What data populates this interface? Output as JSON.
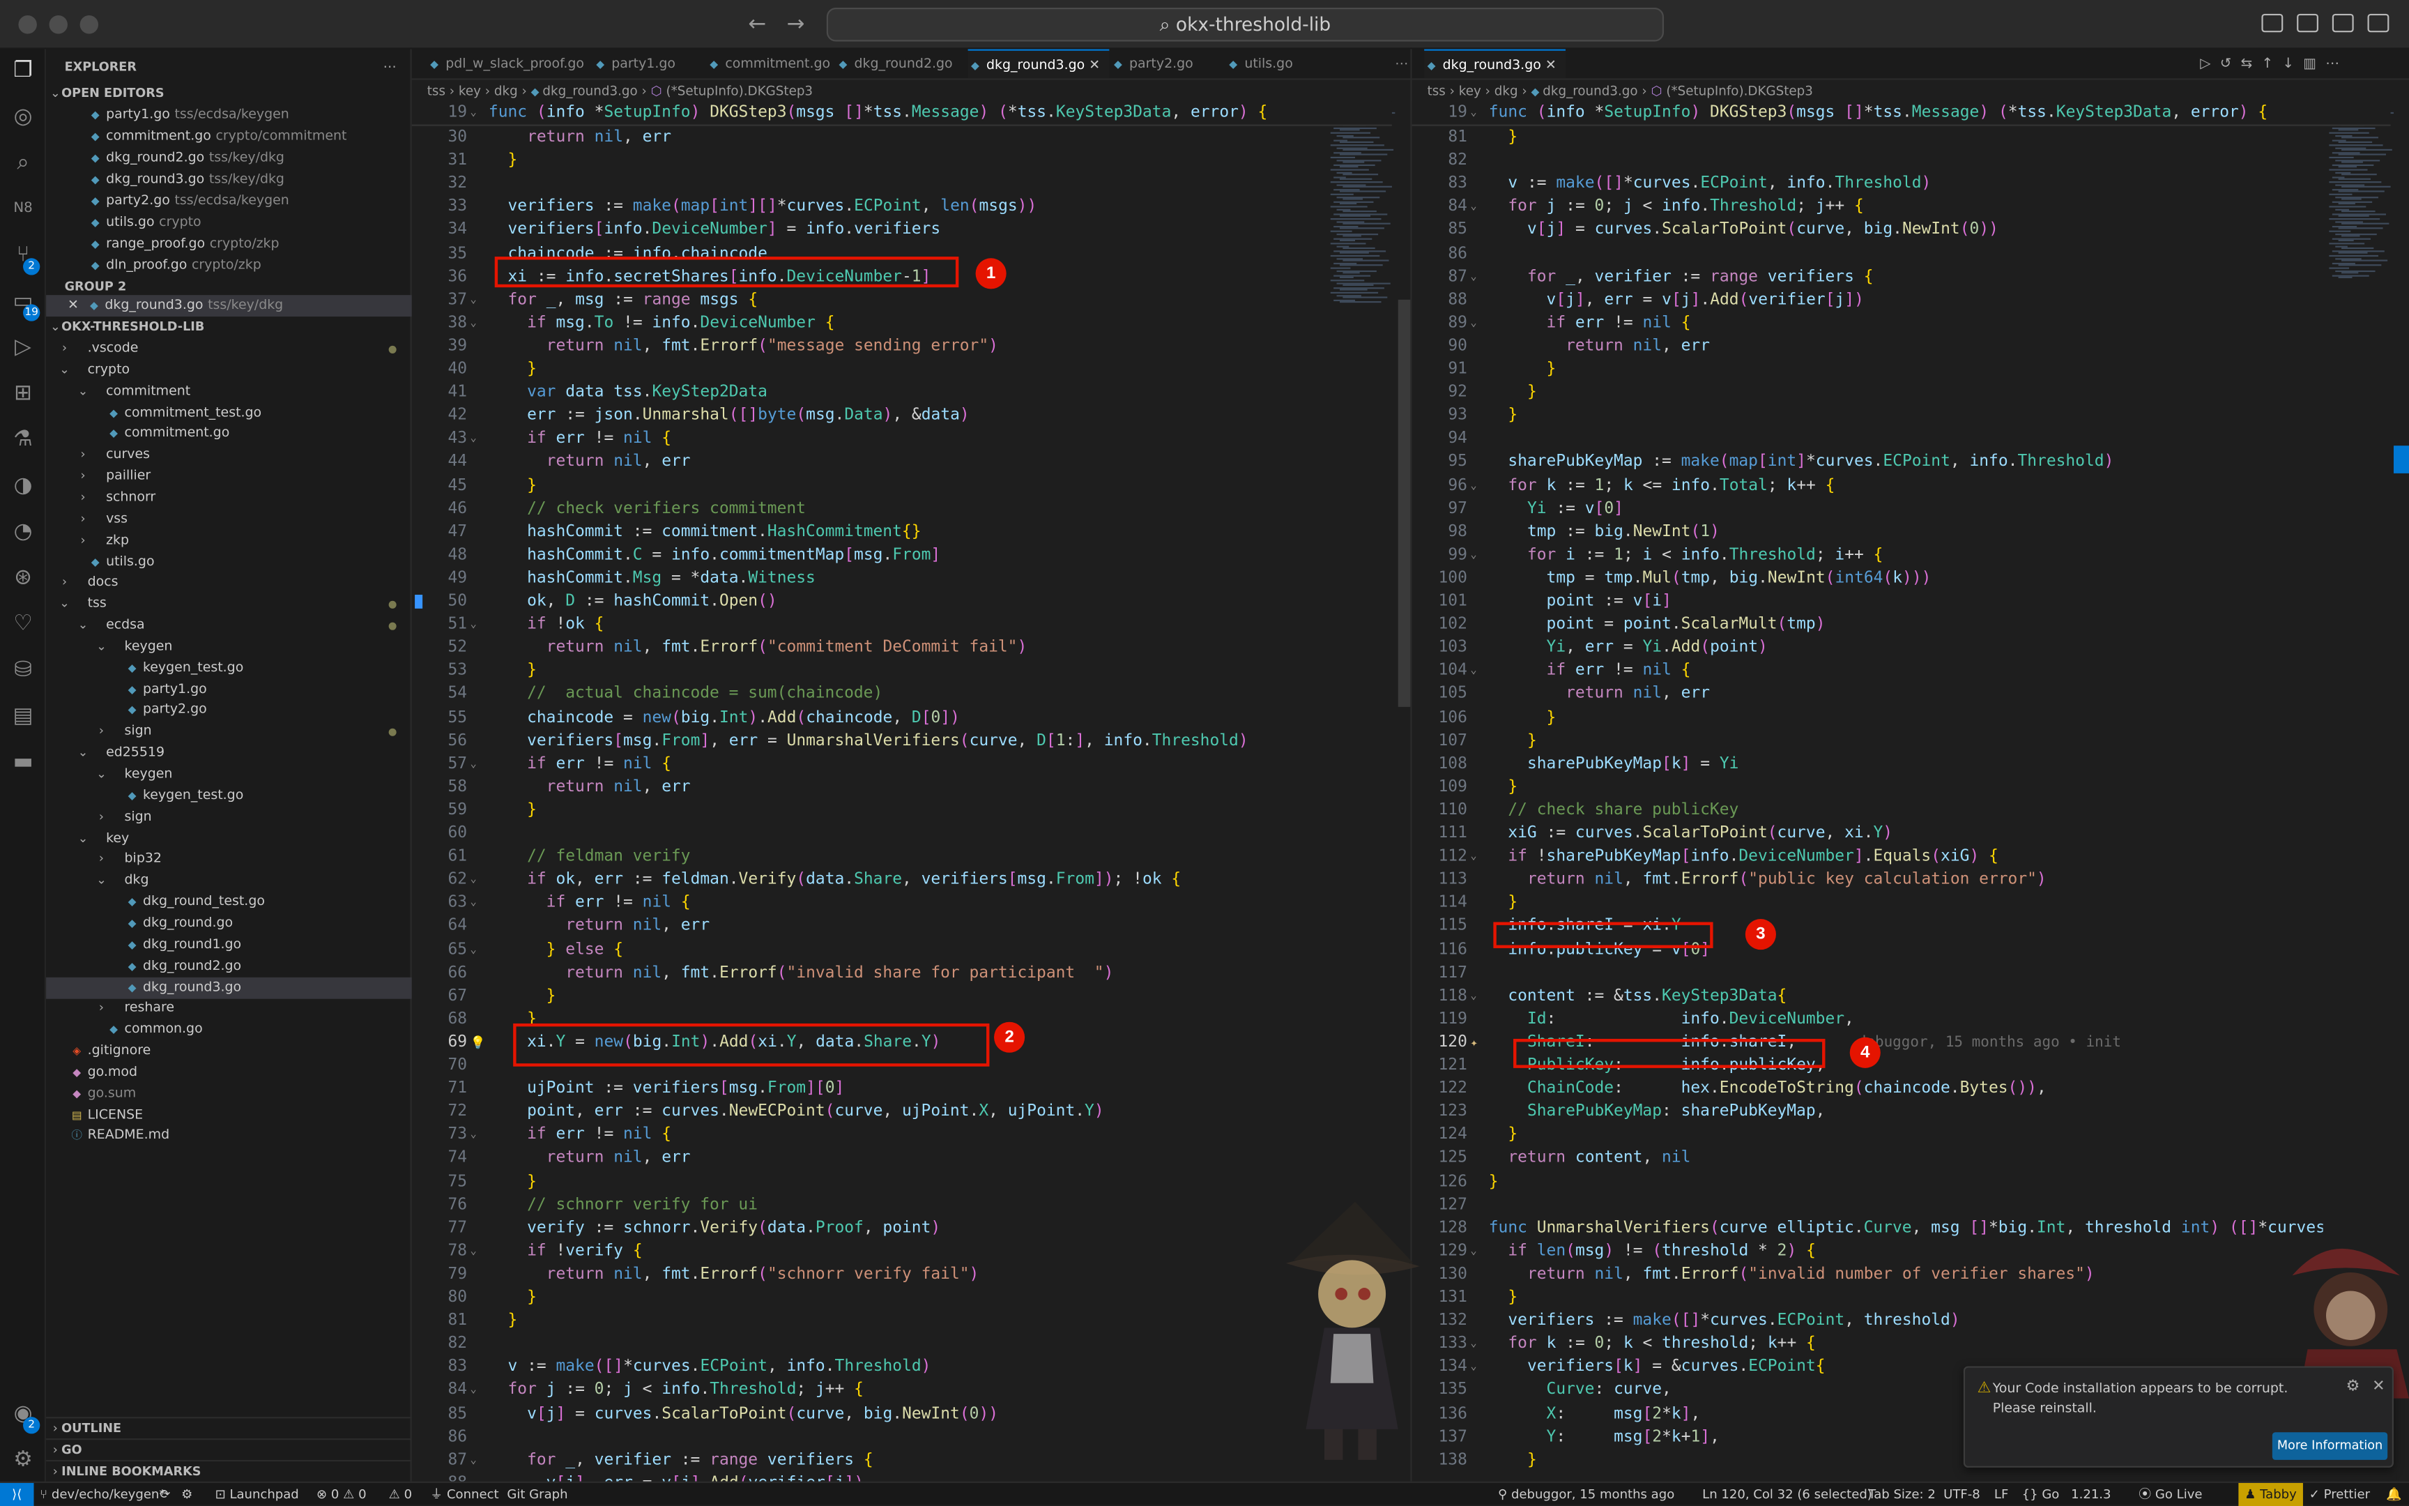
{
  "window": {
    "title": "okx-threshold-lib"
  },
  "explorer": {
    "header": "EXPLORER",
    "open_editors_label": "OPEN EDITORS",
    "group2_label": "GROUP 2",
    "project_label": "OKX-THRESHOLD-LIB",
    "outline_label": "OUTLINE",
    "go_label": "GO",
    "bookmarks_label": "INLINE BOOKMARKS",
    "open_editors": [
      {
        "name": "party1.go",
        "path": "tss/ecdsa/keygen"
      },
      {
        "name": "commitment.go",
        "path": "crypto/commitment"
      },
      {
        "name": "dkg_round2.go",
        "path": "tss/key/dkg"
      },
      {
        "name": "dkg_round3.go",
        "path": "tss/key/dkg"
      },
      {
        "name": "party2.go",
        "path": "tss/ecdsa/keygen"
      },
      {
        "name": "utils.go",
        "path": "crypto"
      },
      {
        "name": "range_proof.go",
        "path": "crypto/zkp"
      },
      {
        "name": "dln_proof.go",
        "path": "crypto/zkp"
      }
    ],
    "group2_items": [
      {
        "name": "dkg_round3.go",
        "path": "tss/key/dkg"
      }
    ],
    "tree": [
      {
        "name": ".vscode",
        "depth": 0,
        "type": "folder",
        "open": false,
        "dot": true
      },
      {
        "name": "crypto",
        "depth": 0,
        "type": "folder",
        "open": true
      },
      {
        "name": "commitment",
        "depth": 1,
        "type": "folder",
        "open": true
      },
      {
        "name": "commitment_test.go",
        "depth": 2,
        "type": "go"
      },
      {
        "name": "commitment.go",
        "depth": 2,
        "type": "go"
      },
      {
        "name": "curves",
        "depth": 1,
        "type": "folder",
        "open": false
      },
      {
        "name": "paillier",
        "depth": 1,
        "type": "folder",
        "open": false
      },
      {
        "name": "schnorr",
        "depth": 1,
        "type": "folder",
        "open": false
      },
      {
        "name": "vss",
        "depth": 1,
        "type": "folder",
        "open": false
      },
      {
        "name": "zkp",
        "depth": 1,
        "type": "folder",
        "open": false
      },
      {
        "name": "utils.go",
        "depth": 1,
        "type": "go"
      },
      {
        "name": "docs",
        "depth": 0,
        "type": "folder",
        "open": false
      },
      {
        "name": "tss",
        "depth": 0,
        "type": "folder",
        "open": true,
        "dot": true
      },
      {
        "name": "ecdsa",
        "depth": 1,
        "type": "folder",
        "open": true,
        "dot": true
      },
      {
        "name": "keygen",
        "depth": 2,
        "type": "folder",
        "open": true
      },
      {
        "name": "keygen_test.go",
        "depth": 3,
        "type": "go"
      },
      {
        "name": "party1.go",
        "depth": 3,
        "type": "go"
      },
      {
        "name": "party2.go",
        "depth": 3,
        "type": "go"
      },
      {
        "name": "sign",
        "depth": 2,
        "type": "folder",
        "open": false,
        "dot": true
      },
      {
        "name": "ed25519",
        "depth": 1,
        "type": "folder",
        "open": true
      },
      {
        "name": "keygen",
        "depth": 2,
        "type": "folder",
        "open": true
      },
      {
        "name": "keygen_test.go",
        "depth": 3,
        "type": "go"
      },
      {
        "name": "sign",
        "depth": 2,
        "type": "folder",
        "open": false
      },
      {
        "name": "key",
        "depth": 1,
        "type": "folder",
        "open": true
      },
      {
        "name": "bip32",
        "depth": 2,
        "type": "folder",
        "open": false
      },
      {
        "name": "dkg",
        "depth": 2,
        "type": "folder",
        "open": true
      },
      {
        "name": "dkg_round_test.go",
        "depth": 3,
        "type": "go"
      },
      {
        "name": "dkg_round.go",
        "depth": 3,
        "type": "go"
      },
      {
        "name": "dkg_round1.go",
        "depth": 3,
        "type": "go"
      },
      {
        "name": "dkg_round2.go",
        "depth": 3,
        "type": "go"
      },
      {
        "name": "dkg_round3.go",
        "depth": 3,
        "type": "go",
        "selected": true
      },
      {
        "name": "reshare",
        "depth": 2,
        "type": "folder",
        "open": false
      },
      {
        "name": "common.go",
        "depth": 2,
        "type": "go"
      },
      {
        "name": ".gitignore",
        "depth": 0,
        "type": "git"
      },
      {
        "name": "go.mod",
        "depth": 0,
        "type": "mod"
      },
      {
        "name": "go.sum",
        "depth": 0,
        "type": "mod"
      },
      {
        "name": "LICENSE",
        "depth": 0,
        "type": "lic"
      },
      {
        "name": "README.md",
        "depth": 0,
        "type": "md"
      }
    ]
  },
  "left_tabs": [
    "pdl_w_slack_proof.go",
    "party1.go",
    "commitment.go",
    "dkg_round2.go",
    "dkg_round3.go",
    "party2.go",
    "utils.go"
  ],
  "left_active_tab": 4,
  "right_tabs": [
    "dkg_round3.go"
  ],
  "breadcrumb": [
    "tss",
    "key",
    "dkg",
    "dkg_round3.go",
    "(*SetupInfo).DKGStep3"
  ],
  "left_sticky": {
    "num": "19",
    "text": "func (info *SetupInfo) DKGStep3(msgs []*tss.Message) (*tss.KeyStep3Data, error) {"
  },
  "right_sticky": {
    "num": "19",
    "text": "func (info *SetupInfo) DKGStep3(msgs []*tss.Message) (*tss.KeyStep3Data, error) {"
  },
  "left_code": [
    [
      "30",
      "\t\treturn nil, err"
    ],
    [
      "31",
      "\t}"
    ],
    [
      "32",
      ""
    ],
    [
      "33",
      "\tverifiers := make(map[int][]*curves.ECPoint, len(msgs))"
    ],
    [
      "34",
      "\tverifiers[info.DeviceNumber] = info.verifiers"
    ],
    [
      "35",
      "\tchaincode := info.chaincode"
    ],
    [
      "36",
      "\txi := info.secretShares[info.DeviceNumber-1]"
    ],
    [
      "37",
      "\tfor _, msg := range msgs {"
    ],
    [
      "38",
      "\t\tif msg.To != info.DeviceNumber {"
    ],
    [
      "39",
      "\t\t\treturn nil, fmt.Errorf(\"message sending error\")"
    ],
    [
      "40",
      "\t\t}"
    ],
    [
      "41",
      "\t\tvar data tss.KeyStep2Data"
    ],
    [
      "42",
      "\t\terr := json.Unmarshal([]byte(msg.Data), &data)"
    ],
    [
      "43",
      "\t\tif err != nil {"
    ],
    [
      "44",
      "\t\t\treturn nil, err"
    ],
    [
      "45",
      "\t\t}"
    ],
    [
      "46",
      "\t\t// check verifiers commitment"
    ],
    [
      "47",
      "\t\thashCommit := commitment.HashCommitment{}"
    ],
    [
      "48",
      "\t\thashCommit.C = info.commitmentMap[msg.From]"
    ],
    [
      "49",
      "\t\thashCommit.Msg = *data.Witness"
    ],
    [
      "50",
      "\t\tok, D := hashCommit.Open()"
    ],
    [
      "51",
      "\t\tif !ok {"
    ],
    [
      "52",
      "\t\t\treturn nil, fmt.Errorf(\"commitment DeCommit fail\")"
    ],
    [
      "53",
      "\t\t}"
    ],
    [
      "54",
      "\t\t//  actual chaincode = sum(chaincode)"
    ],
    [
      "55",
      "\t\tchaincode = new(big.Int).Add(chaincode, D[0])"
    ],
    [
      "56",
      "\t\tverifiers[msg.From], err = UnmarshalVerifiers(curve, D[1:], info.Threshold)"
    ],
    [
      "57",
      "\t\tif err != nil {"
    ],
    [
      "58",
      "\t\t\treturn nil, err"
    ],
    [
      "59",
      "\t\t}"
    ],
    [
      "60",
      ""
    ],
    [
      "61",
      "\t\t// feldman verify"
    ],
    [
      "62",
      "\t\tif ok, err := feldman.Verify(data.Share, verifiers[msg.From]); !ok {"
    ],
    [
      "63",
      "\t\t\tif err != nil {"
    ],
    [
      "64",
      "\t\t\t\treturn nil, err"
    ],
    [
      "65",
      "\t\t\t} else {"
    ],
    [
      "66",
      "\t\t\t\treturn nil, fmt.Errorf(\"invalid share for participant  \")"
    ],
    [
      "67",
      "\t\t\t}"
    ],
    [
      "68",
      "\t\t}"
    ],
    [
      "69",
      "\t\txi.Y = new(big.Int).Add(xi.Y, data.Share.Y)"
    ],
    [
      "70",
      ""
    ],
    [
      "71",
      "\t\tujPoint := verifiers[msg.From][0]"
    ],
    [
      "72",
      "\t\tpoint, err := curves.NewECPoint(curve, ujPoint.X, ujPoint.Y)"
    ],
    [
      "73",
      "\t\tif err != nil {"
    ],
    [
      "74",
      "\t\t\treturn nil, err"
    ],
    [
      "75",
      "\t\t}"
    ],
    [
      "76",
      "\t\t// schnorr verify for ui"
    ],
    [
      "77",
      "\t\tverify := schnorr.Verify(data.Proof, point)"
    ],
    [
      "78",
      "\t\tif !verify {"
    ],
    [
      "79",
      "\t\t\treturn nil, fmt.Errorf(\"schnorr verify fail\")"
    ],
    [
      "80",
      "\t\t}"
    ],
    [
      "81",
      "\t}"
    ],
    [
      "82",
      ""
    ],
    [
      "83",
      "\tv := make([]*curves.ECPoint, info.Threshold)"
    ],
    [
      "84",
      "\tfor j := 0; j < info.Threshold; j++ {"
    ],
    [
      "85",
      "\t\tv[j] = curves.ScalarToPoint(curve, big.NewInt(0))"
    ],
    [
      "86",
      ""
    ],
    [
      "87",
      "\t\tfor _, verifier := range verifiers {"
    ],
    [
      "88",
      "\t\t\tv[j], err = v[j].Add(verifier[j])"
    ]
  ],
  "right_code": [
    [
      "81",
      "\t}"
    ],
    [
      "82",
      ""
    ],
    [
      "83",
      "\tv := make([]*curves.ECPoint, info.Threshold)"
    ],
    [
      "84",
      "\tfor j := 0; j < info.Threshold; j++ {"
    ],
    [
      "85",
      "\t\tv[j] = curves.ScalarToPoint(curve, big.NewInt(0))"
    ],
    [
      "86",
      ""
    ],
    [
      "87",
      "\t\tfor _, verifier := range verifiers {"
    ],
    [
      "88",
      "\t\t\tv[j], err = v[j].Add(verifier[j])"
    ],
    [
      "89",
      "\t\t\tif err != nil {"
    ],
    [
      "90",
      "\t\t\t\treturn nil, err"
    ],
    [
      "91",
      "\t\t\t}"
    ],
    [
      "92",
      "\t\t}"
    ],
    [
      "93",
      "\t}"
    ],
    [
      "94",
      ""
    ],
    [
      "95",
      "\tsharePubKeyMap := make(map[int]*curves.ECPoint, info.Threshold)"
    ],
    [
      "96",
      "\tfor k := 1; k <= info.Total; k++ {"
    ],
    [
      "97",
      "\t\tYi := v[0]"
    ],
    [
      "98",
      "\t\ttmp := big.NewInt(1)"
    ],
    [
      "99",
      "\t\tfor i := 1; i < info.Threshold; i++ {"
    ],
    [
      "100",
      "\t\t\ttmp = tmp.Mul(tmp, big.NewInt(int64(k)))"
    ],
    [
      "101",
      "\t\t\tpoint := v[i]"
    ],
    [
      "102",
      "\t\t\tpoint = point.ScalarMult(tmp)"
    ],
    [
      "103",
      "\t\t\tYi, err = Yi.Add(point)"
    ],
    [
      "104",
      "\t\t\tif err != nil {"
    ],
    [
      "105",
      "\t\t\t\treturn nil, err"
    ],
    [
      "106",
      "\t\t\t}"
    ],
    [
      "107",
      "\t\t}"
    ],
    [
      "108",
      "\t\tsharePubKeyMap[k] = Yi"
    ],
    [
      "109",
      "\t}"
    ],
    [
      "110",
      "\t// check share publicKey"
    ],
    [
      "111",
      "\txiG := curves.ScalarToPoint(curve, xi.Y)"
    ],
    [
      "112",
      "\tif !sharePubKeyMap[info.DeviceNumber].Equals(xiG) {"
    ],
    [
      "113",
      "\t\treturn nil, fmt.Errorf(\"public key calculation error\")"
    ],
    [
      "114",
      "\t}"
    ],
    [
      "115",
      "\tinfo.shareI = xi.Y"
    ],
    [
      "116",
      "\tinfo.publicKey = v[0]"
    ],
    [
      "117",
      ""
    ],
    [
      "118",
      "\tcontent := &tss.KeyStep3Data{"
    ],
    [
      "119",
      "\t\tId:             info.DeviceNumber,"
    ],
    [
      "120",
      "\t\tShareI:         info.shareI,"
    ],
    [
      "121",
      "\t\tPublicKey:      info.publicKey,"
    ],
    [
      "122",
      "\t\tChainCode:      hex.EncodeToString(chaincode.Bytes()),"
    ],
    [
      "123",
      "\t\tSharePubKeyMap: sharePubKeyMap,"
    ],
    [
      "124",
      "\t}"
    ],
    [
      "125",
      "\treturn content, nil"
    ],
    [
      "126",
      "}"
    ],
    [
      "127",
      ""
    ],
    [
      "128",
      "func UnmarshalVerifiers(curve elliptic.Curve, msg []*big.Int, threshold int) ([]*curves.EC"
    ],
    [
      "129",
      "\tif len(msg) != (threshold * 2) {"
    ],
    [
      "130",
      "\t\treturn nil, fmt.Errorf(\"invalid number of verifier shares\")"
    ],
    [
      "131",
      "\t}"
    ],
    [
      "132",
      "\tverifiers := make([]*curves.ECPoint, threshold)"
    ],
    [
      "133",
      "\tfor k := 0; k < threshold; k++ {"
    ],
    [
      "134",
      "\t\tverifiers[k] = &curves.ECPoint{"
    ],
    [
      "135",
      "\t\t\tCurve: curve,"
    ],
    [
      "136",
      "\t\t\tX:     msg[2*k],"
    ],
    [
      "137",
      "\t\t\tY:     msg[2*k+1],"
    ],
    [
      "138",
      "\t\t}"
    ]
  ],
  "blame": "debuggor, 15 months ago • init",
  "annotations": [
    "1",
    "2",
    "3",
    "4"
  ],
  "notification": {
    "message": "Your Code installation appears to be corrupt. Please reinstall.",
    "button": "More Information"
  },
  "status": {
    "branch": "dev/echo/keygen*",
    "launchpad": "Launchpad",
    "errors": "0",
    "warnings": "0",
    "other": "0",
    "connect": "Connect",
    "gitgraph": "Git Graph",
    "blame": "debuggor, 15 months ago",
    "position": "Ln 120, Col 32 (6 selected)",
    "tabsize": "Tab Size: 2",
    "encoding": "UTF-8",
    "eol": "LF",
    "language": "Go",
    "goversion": "1.21.3",
    "golive": "Go Live",
    "tabby": "Tabby",
    "prettier": "Prettier"
  },
  "badges": {
    "scm": "2",
    "extensions": "19",
    "accounts": "2"
  },
  "colors": {
    "accent": "#0078d4",
    "annotation": "#e51400"
  }
}
